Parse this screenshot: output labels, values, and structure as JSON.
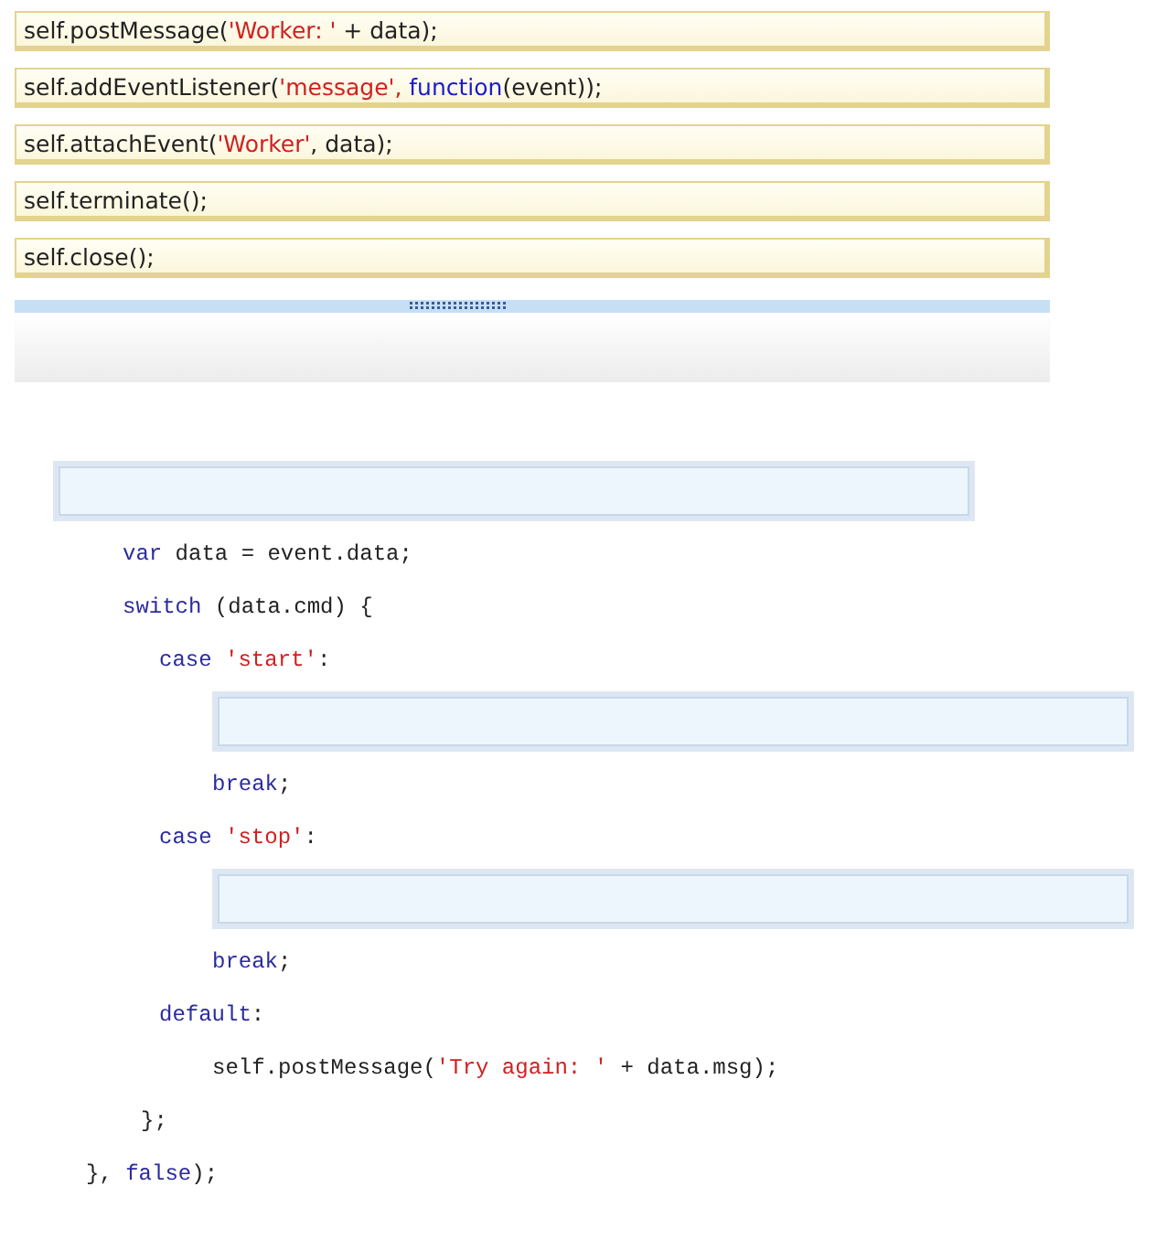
{
  "answer_tiles": [
    [
      {
        "kind": "plain",
        "text": "self.postMessage("
      },
      {
        "kind": "string",
        "text": "'Worker: '"
      },
      {
        "kind": "plain",
        "text": " + data);"
      }
    ],
    [
      {
        "kind": "plain",
        "text": "self.addEventListener("
      },
      {
        "kind": "string",
        "text": "'message',"
      },
      {
        "kind": "keyword",
        "text": " function"
      },
      {
        "kind": "plain",
        "text": "(event));"
      }
    ],
    [
      {
        "kind": "plain",
        "text": "self.attachEvent("
      },
      {
        "kind": "string",
        "text": "'Worker'"
      },
      {
        "kind": "plain",
        "text": ", data);"
      }
    ],
    [
      {
        "kind": "plain",
        "text": "self.terminate();"
      }
    ],
    [
      {
        "kind": "plain",
        "text": "self.close();"
      }
    ]
  ],
  "code_lines": [
    {
      "kind": "drop"
    },
    {
      "kind": "code",
      "parts": [
        {
          "kind": "keyword",
          "text": "var"
        },
        {
          "kind": "plain",
          "text": " data = event.data;"
        }
      ]
    },
    {
      "kind": "code",
      "parts": [
        {
          "kind": "keyword",
          "text": "switch"
        },
        {
          "kind": "plain",
          "text": " (data.cmd) {"
        }
      ]
    },
    {
      "kind": "code",
      "parts": [
        {
          "kind": "keyword",
          "text": "case "
        },
        {
          "kind": "string",
          "text": "'start'"
        },
        {
          "kind": "plain",
          "text": ":"
        }
      ]
    },
    {
      "kind": "drop"
    },
    {
      "kind": "code",
      "parts": [
        {
          "kind": "keyword",
          "text": "break"
        },
        {
          "kind": "plain",
          "text": ";"
        }
      ]
    },
    {
      "kind": "code",
      "parts": [
        {
          "kind": "keyword",
          "text": "case "
        },
        {
          "kind": "string",
          "text": "'stop'"
        },
        {
          "kind": "plain",
          "text": ":"
        }
      ]
    },
    {
      "kind": "drop"
    },
    {
      "kind": "code",
      "parts": [
        {
          "kind": "keyword",
          "text": "break"
        },
        {
          "kind": "plain",
          "text": ";"
        }
      ]
    },
    {
      "kind": "code",
      "parts": [
        {
          "kind": "keyword",
          "text": "default"
        },
        {
          "kind": "plain",
          "text": ":"
        }
      ]
    },
    {
      "kind": "code",
      "parts": [
        {
          "kind": "plain",
          "text": "self.postMessage("
        },
        {
          "kind": "string",
          "text": "'Try again: '"
        },
        {
          "kind": "plain",
          "text": " + data.msg);"
        }
      ]
    },
    {
      "kind": "code",
      "parts": [
        {
          "kind": "plain",
          "text": "};"
        }
      ]
    },
    {
      "kind": "code",
      "parts": [
        {
          "kind": "plain",
          "text": "}, "
        },
        {
          "kind": "keyword",
          "text": "false"
        },
        {
          "kind": "plain",
          "text": ");"
        }
      ]
    }
  ]
}
